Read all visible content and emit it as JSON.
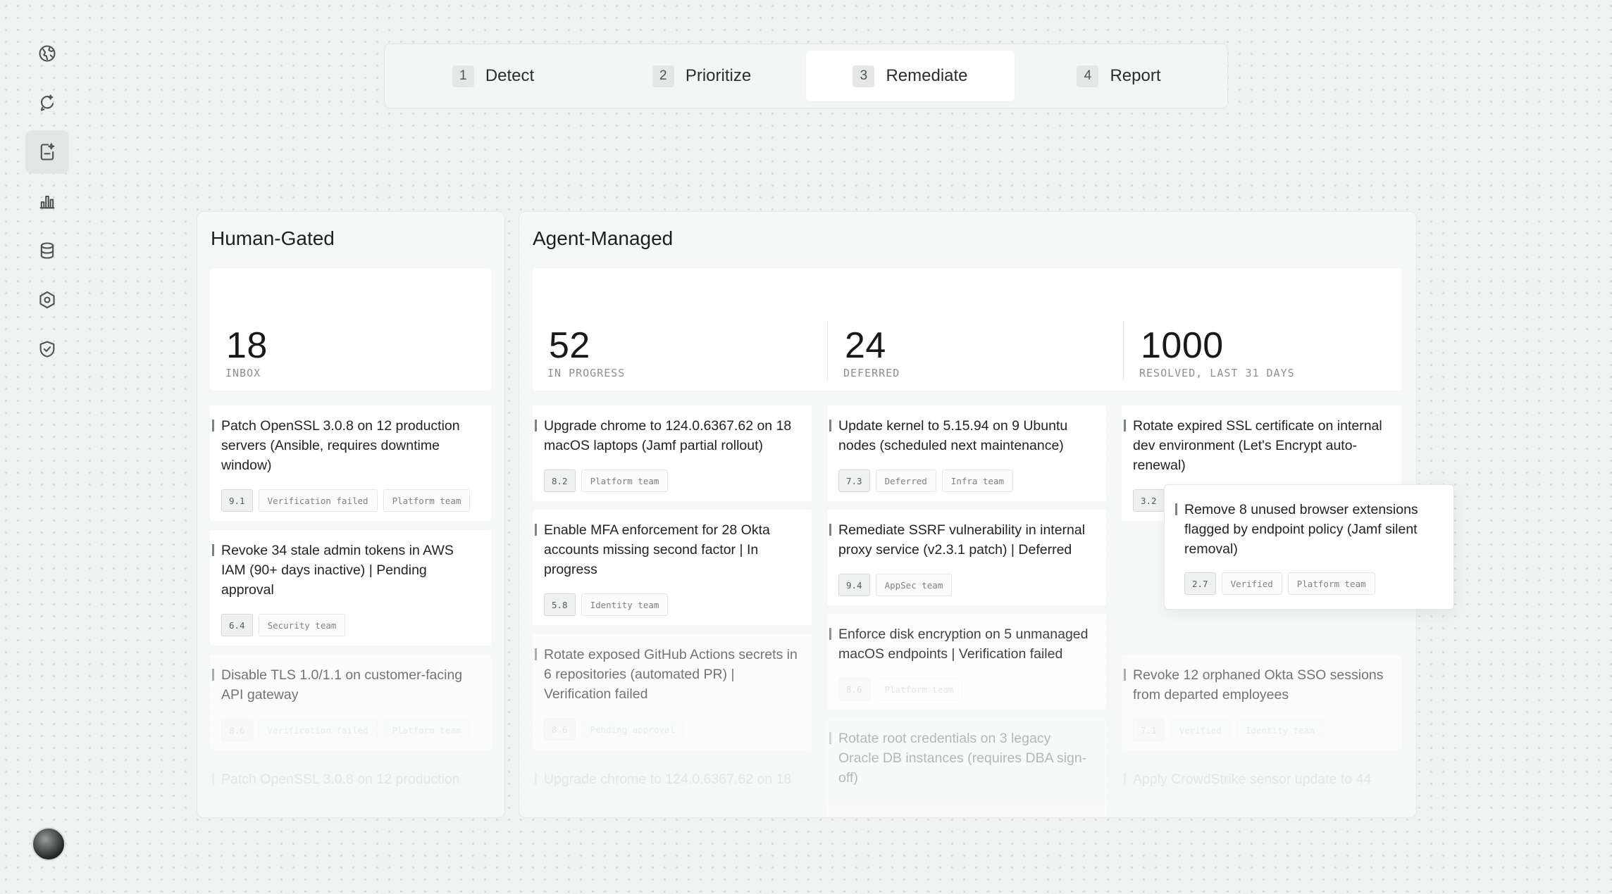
{
  "steps": [
    {
      "num": "1",
      "label": "Detect"
    },
    {
      "num": "2",
      "label": "Prioritize"
    },
    {
      "num": "3",
      "label": "Remediate"
    },
    {
      "num": "4",
      "label": "Report"
    }
  ],
  "active_step": "Remediate",
  "sidebar": {
    "items": [
      "globe-icon",
      "refresh-sparkle-icon",
      "document-sparkle-icon",
      "bar-chart-icon",
      "database-icon",
      "hexagon-settings-icon",
      "shield-check-icon"
    ],
    "active": "document-sparkle-icon"
  },
  "human_gated": {
    "title": "Human-Gated",
    "stat": {
      "value": "18",
      "label": "INBOX"
    },
    "cards": [
      {
        "text": "Patch OpenSSL 3.0.8 on 12 production servers (Ansible, requires downtime window)",
        "score": "9.1",
        "tags": [
          "Verification failed",
          "Platform team"
        ]
      },
      {
        "text": "Revoke 34 stale admin tokens in AWS IAM (90+ days inactive) | Pending approval",
        "score": "6.4",
        "tags": [
          "Security team"
        ]
      },
      {
        "text": "Disable TLS 1.0/1.1 on customer-facing API gateway",
        "score": "8.6",
        "tags": [
          "Verification failed",
          "Platform team"
        ]
      },
      {
        "text": "Patch OpenSSL 3.0.8 on 12 production"
      }
    ]
  },
  "agent_managed": {
    "title": "Agent-Managed",
    "stats": [
      {
        "value": "52",
        "label": "IN PROGRESS"
      },
      {
        "value": "24",
        "label": "DEFERRED"
      },
      {
        "value": "1000",
        "label": "RESOLVED, LAST 31 DAYS"
      }
    ],
    "in_progress": [
      {
        "text": "Upgrade chrome to 124.0.6367.62 on 18 macOS laptops (Jamf partial rollout)",
        "score": "8.2",
        "tags": [
          "Platform team"
        ]
      },
      {
        "text": "Enable MFA enforcement for 28 Okta accounts missing second factor | In progress",
        "score": "5.8",
        "tags": [
          "Identity team"
        ]
      },
      {
        "text": "Rotate exposed GitHub Actions secrets in 6 repositories (automated PR) | Verification failed",
        "score": "8.6",
        "tags": [
          "Pending approval"
        ]
      },
      {
        "text": "Upgrade chrome to 124.0.6367.62 on 18"
      }
    ],
    "deferred": [
      {
        "text": "Update kernel to 5.15.94 on 9 Ubuntu nodes (scheduled next maintenance)",
        "score": "7.3",
        "tags": [
          "Deferred",
          "Infra team"
        ]
      },
      {
        "text": "Remediate SSRF vulnerability in internal proxy service (v2.3.1 patch) | Deferred",
        "score": "9.4",
        "tags": [
          "AppSec team"
        ]
      },
      {
        "text": "Enforce disk encryption on 5 unmanaged macOS endpoints | Verification failed",
        "score": "8.6",
        "tags": [
          "Platform team"
        ]
      },
      {
        "text": "Rotate root credentials on 3 legacy Oracle DB instances (requires DBA sign-off)"
      }
    ],
    "resolved": [
      {
        "text": "Rotate expired SSL certificate on internal dev environment (Let's Encrypt auto-renewal)",
        "score": "3.2"
      },
      {
        "text": "Revoke 12 orphaned Okta SSO sessions from departed employees",
        "score": "7.1",
        "tags": [
          "Verified",
          "Identity team"
        ]
      },
      {
        "text": "Apply CrowdStrike sensor update to 44"
      }
    ]
  },
  "popup_card": {
    "text": "Remove 8 unused browser extensions flagged by endpoint policy (Jamf silent removal)",
    "score": "2.7",
    "tags": [
      "Verified",
      "Platform team"
    ]
  }
}
